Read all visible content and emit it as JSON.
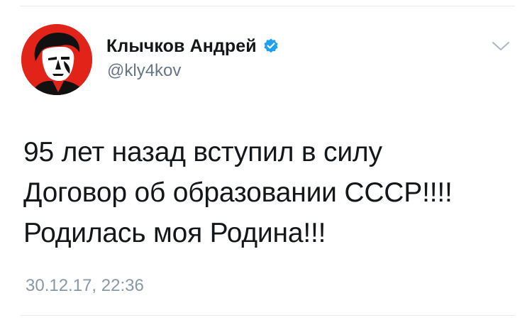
{
  "author": {
    "display_name": "Клычков Андрей",
    "handle": "@kly4kov",
    "verified": true,
    "avatar_icon": "portrait-avatar-icon",
    "avatar_color": "#e2231a"
  },
  "tweet": {
    "lines": [
      "95 лет назад вступил в силу",
      "Договор об образовании СССР!!!!",
      "Родилась моя Родина!!!"
    ],
    "timestamp": "30.12.17, 22:36"
  },
  "icons": {
    "verified": "verified-badge-icon",
    "menu": "chevron-down-icon"
  },
  "colors": {
    "verified_blue": "#1da1f2",
    "handle_gray": "#657786",
    "timestamp_gray": "#8899a6"
  }
}
